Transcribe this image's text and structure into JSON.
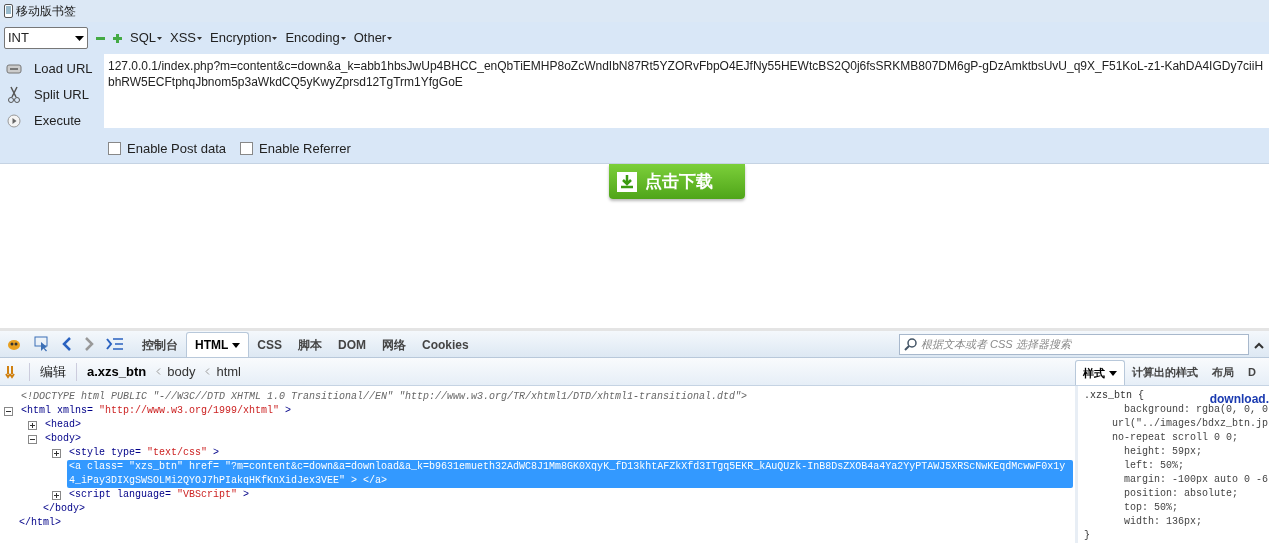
{
  "bookmarks_bar": {
    "label": "移动版书签"
  },
  "hackbar": {
    "select": {
      "value": "INT"
    },
    "menus": [
      "SQL",
      "XSS",
      "Encryption",
      "Encoding",
      "Other"
    ],
    "actions": [
      {
        "label": "Load URL",
        "kind": "load"
      },
      {
        "label": "Split URL",
        "kind": "split"
      },
      {
        "label": "Execute",
        "kind": "execute"
      }
    ],
    "url": "127.0.0.1/index.php?m=content&c=down&a_k=abb1hbsJwUp4BHCC_enQbTiEMHP8oZcWndIbN87Rt5YZORvFbpO4EJfNy55HEWtcBS2Q0j6fsSRKMB807DM6gP-gDzAmktbsUvU_q9X_F51KoL-z1-KahDA4IGDy7ciiHbhRW5ECFtphqJbnom5p3aWkdCQ5yKwyZprsd12TgTrm1YfgGoE",
    "options": [
      {
        "label": "Enable Post data",
        "checked": false
      },
      {
        "label": "Enable Referrer",
        "checked": false
      }
    ]
  },
  "page": {
    "download_button": "点击下载"
  },
  "devtools": {
    "tabs": [
      {
        "label": "控制台",
        "selected": false
      },
      {
        "label": "HTML",
        "selected": true
      },
      {
        "label": "CSS",
        "selected": false
      },
      {
        "label": "脚本",
        "selected": false
      },
      {
        "label": "DOM",
        "selected": false
      },
      {
        "label": "网络",
        "selected": false
      },
      {
        "label": "Cookies",
        "selected": false
      }
    ],
    "search": {
      "placeholder": "根据文本或者 CSS 选择器搜索"
    },
    "edit_button": "编辑",
    "breadcrumbs": [
      {
        "label": "a.xzs_btn",
        "selected": true
      },
      {
        "label": "body",
        "selected": false
      },
      {
        "label": "html",
        "selected": false
      }
    ],
    "tree": [
      {
        "parts": [
          {
            "kind": "comment",
            "text": "<!DOCTYPE html PUBLIC \"-//W3C//DTD XHTML 1.0 Transitional//EN\" \"http://www.w3.org/TR/xhtml1/DTD/xhtml1-transitional.dtd\">"
          }
        ]
      },
      {
        "expanded": true,
        "parts": [
          {
            "kind": "tag",
            "text": "<html"
          },
          {
            "kind": "attr",
            "text": "xmlns="
          },
          {
            "kind": "value",
            "text": "\"http://www.w3.org/1999/xhtml\""
          },
          {
            "kind": "tag",
            "text": ">"
          }
        ],
        "closing": "</html>",
        "children": [
          {
            "expanded": false,
            "parts": [
              {
                "kind": "tag",
                "text": "<head>"
              }
            ]
          },
          {
            "expanded": true,
            "parts": [
              {
                "kind": "tag",
                "text": "<body>"
              }
            ],
            "closing": "</body>",
            "children": [
              {
                "expanded": false,
                "parts": [
                  {
                    "kind": "tag",
                    "text": "<style"
                  },
                  {
                    "kind": "attr",
                    "text": "type="
                  },
                  {
                    "kind": "value",
                    "text": "\"text/css\""
                  },
                  {
                    "kind": "tag",
                    "text": ">"
                  }
                ]
              },
              {
                "selected": true,
                "parts": [
                  {
                    "kind": "tag",
                    "text": "<a"
                  },
                  {
                    "kind": "attr",
                    "text": "class="
                  },
                  {
                    "kind": "value",
                    "text": "\"xzs_btn\""
                  },
                  {
                    "kind": "attr",
                    "text": "href="
                  },
                  {
                    "kind": "value",
                    "text": "\"?m=content&c=down&a=download&a_k=b9631emueth32AdWC8J1Mm8GK0XqyK_fD13khtAFZkXfd3ITgq5EKR_kAuQUzk-InB8DsZXOB4a4Ya2YyPTAWJ5XRScNwKEqdMcwwF0x1y4_iPay3DIXgSWSOLMi2QYOJ7hPIakqHKfKnXidJex3VEE\""
                  },
                  {
                    "kind": "tag",
                    "text": "> </a>"
                  }
                ]
              },
              {
                "expanded": false,
                "parts": [
                  {
                    "kind": "tag",
                    "text": "<script"
                  },
                  {
                    "kind": "attr",
                    "text": "language="
                  },
                  {
                    "kind": "value",
                    "text": "\"VBScript\""
                  },
                  {
                    "kind": "tag",
                    "text": ">"
                  }
                ]
              }
            ]
          }
        ]
      }
    ],
    "side_tabs": [
      {
        "label": "样式",
        "selected": true,
        "dropdown": true
      },
      {
        "label": "计算出的样式",
        "selected": false
      },
      {
        "label": "布局",
        "selected": false
      },
      {
        "label": "D",
        "selected": false
      }
    ],
    "style_source": "download.",
    "style_lines": [
      {
        "kind": "selector",
        "text": ".xzs_btn {"
      },
      {
        "kind": "decl",
        "text": "background: rgba(0, 0, 0"
      },
      {
        "kind": "cont",
        "text": "url(\"../images/bdxz_btn.jp"
      },
      {
        "kind": "cont",
        "text": "no-repeat scroll 0 0;"
      },
      {
        "kind": "decl",
        "text": "height: 59px;"
      },
      {
        "kind": "decl",
        "text": "left: 50%;"
      },
      {
        "kind": "decl",
        "text": "margin: -100px auto 0 -6"
      },
      {
        "kind": "decl",
        "text": "position: absolute;"
      },
      {
        "kind": "decl",
        "text": "top: 50%;"
      },
      {
        "kind": "decl",
        "text": "width: 136px;"
      },
      {
        "kind": "selector",
        "text": "}"
      }
    ]
  }
}
